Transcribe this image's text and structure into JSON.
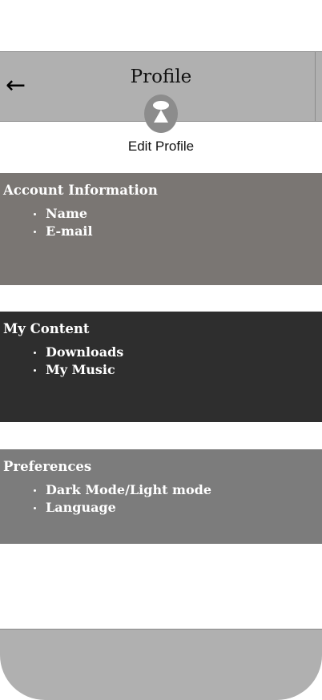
{
  "header": {
    "back_icon": "←",
    "title": "Profile"
  },
  "profile": {
    "avatar_icon": "avatar-icon",
    "edit_label": "Edit Profile"
  },
  "sections": [
    {
      "title": "Account Information",
      "items": [
        "Name",
        "E-mail"
      ],
      "color": "#7a7673"
    },
    {
      "title": "My Content",
      "items": [
        "Downloads",
        "My Music"
      ],
      "color": "#2e2e2e"
    },
    {
      "title": "Preferences",
      "items": [
        "Dark Mode/Light mode",
        "Language"
      ],
      "color": "#7c7c7c"
    }
  ],
  "colors": {
    "header_bg": "#b0b0b0",
    "bottom_bar_bg": "#b0b0b0"
  }
}
